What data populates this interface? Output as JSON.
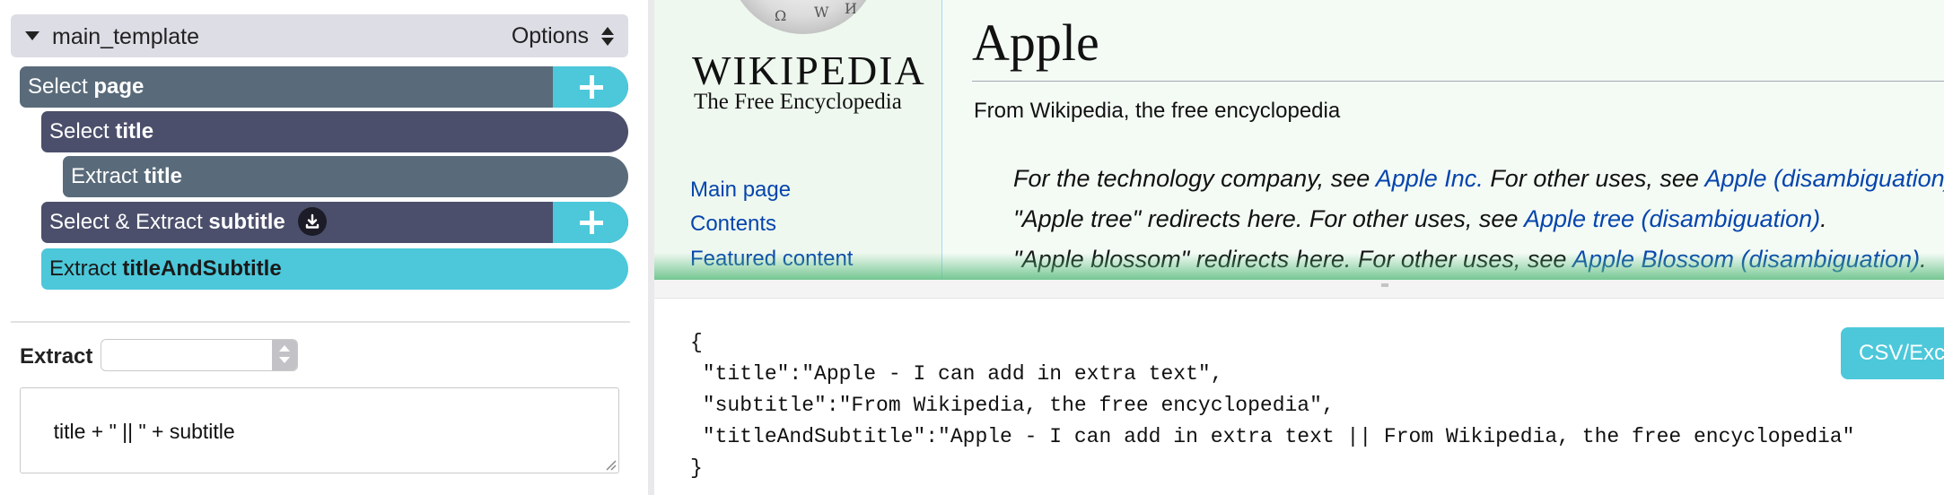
{
  "template": {
    "name": "main_template",
    "options_label": "Options"
  },
  "commands": [
    {
      "verb": "Select",
      "target": "page"
    },
    {
      "verb": "Select",
      "target": "title"
    },
    {
      "verb": "Extract",
      "target": "title"
    },
    {
      "verb": "Select & Extract",
      "target": "subtitle"
    },
    {
      "verb": "Extract",
      "target": "titleAndSubtitle"
    }
  ],
  "extract_panel": {
    "label": "Extract",
    "select_value": "",
    "expression": "title + \" || \" + subtitle"
  },
  "wikipedia": {
    "wordmark": "WIKIPEDIA",
    "tagline": "The Free Encyclopedia",
    "nav": [
      "Main page",
      "Contents",
      "Featured content"
    ],
    "article_title": "Apple",
    "subheading": "From Wikipedia, the free encyclopedia",
    "hatnotes": [
      {
        "before": "For the technology company, see ",
        "link1": "Apple Inc.",
        "middle": " For other uses, see ",
        "link2": "Apple (disambiguation)."
      },
      {
        "before": "\"Apple tree\" redirects here. For other uses, see ",
        "link1": "Apple tree (disambiguation)",
        "middle": ".",
        "link2": ""
      },
      {
        "before": "\"Apple blossom\" redirects here. For other uses, see ",
        "link1": "Apple Blossom (disambiguation)",
        "middle": ".",
        "link2": ""
      }
    ]
  },
  "output": {
    "json_text": "{\n \"title\":\"Apple - I can add in extra text\",\n \"subtitle\":\"From Wikipedia, the free encyclopedia\",\n \"titleAndSubtitle\":\"Apple - I can add in extra text || From Wikipedia, the free encyclopedia\"\n}",
    "export_button": "CSV/Excel"
  },
  "colors": {
    "accent": "#4cc8da",
    "node_light": "#596b7a",
    "node_dark": "#4b4f6b",
    "wiki_link": "#0645ad"
  }
}
